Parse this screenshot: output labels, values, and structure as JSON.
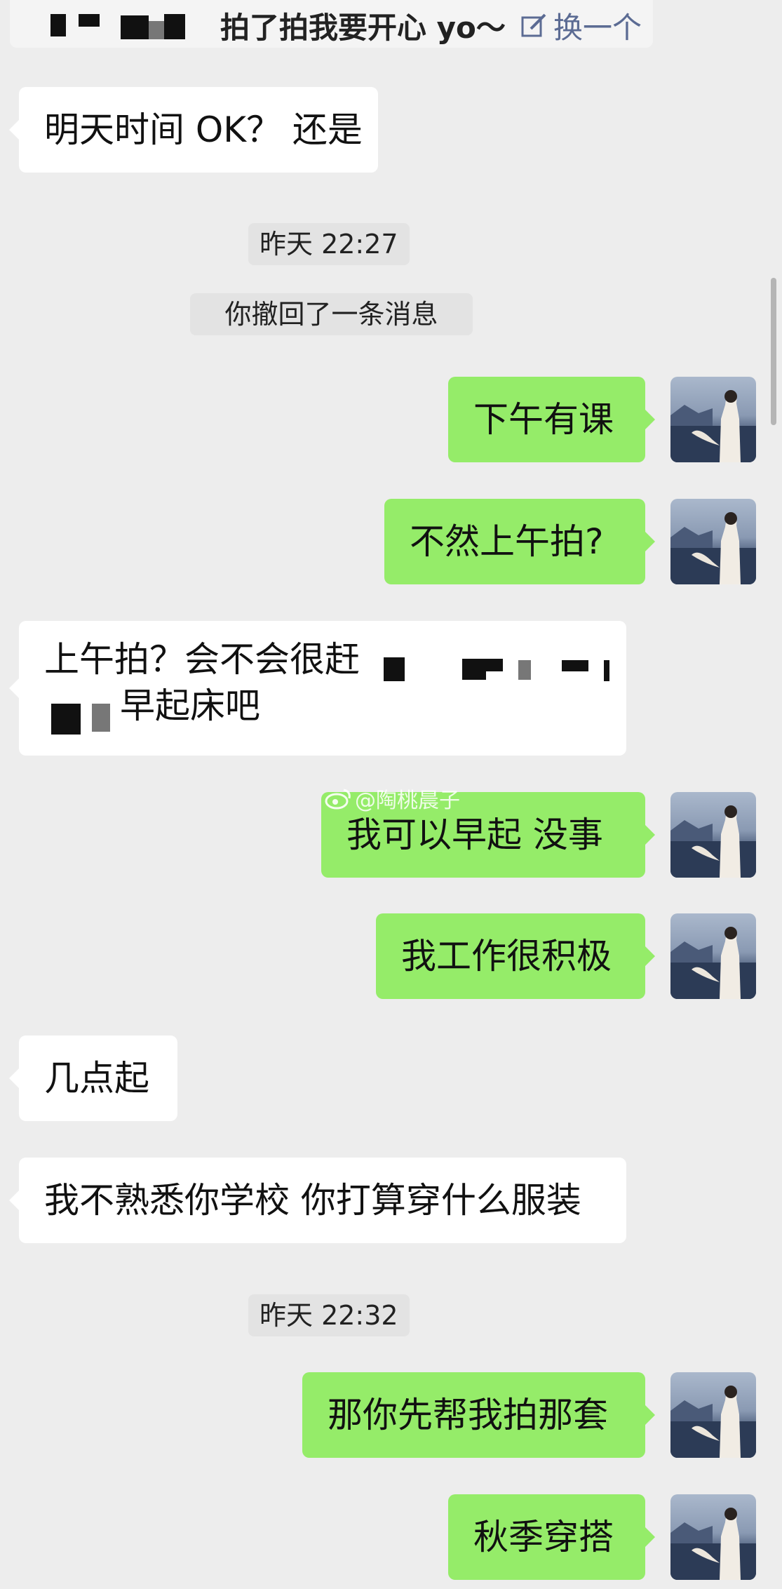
{
  "pat_banner": {
    "text": "拍了拍我要开心 yo～",
    "change_label": "换一个"
  },
  "messages": {
    "m1": "明天时间 OK？ 还是",
    "time1": "昨天 22:27",
    "recall": "你撤回了一条消息",
    "m2": "下午有课",
    "m3": "不然上午拍?",
    "m4_line1": "上午拍？会不会很赶",
    "m4_line2": "早起床吧",
    "m5": "我可以早起 没事",
    "m6": "我工作很积极",
    "m7": "几点起",
    "m8": "我不熟悉你学校 你打算穿什么服装",
    "time2": "昨天 22:32",
    "m9": "那你先帮我拍那套",
    "m10": "秋季穿搭"
  },
  "watermark": "@陶桃晨子",
  "colors": {
    "background": "#ededed",
    "sent_bubble": "#95ec69",
    "received_bubble": "#ffffff",
    "link_blue": "#5b6b93"
  },
  "icons": {
    "edit": "edit-icon",
    "weibo": "weibo-icon",
    "avatar": "avatar-image"
  }
}
